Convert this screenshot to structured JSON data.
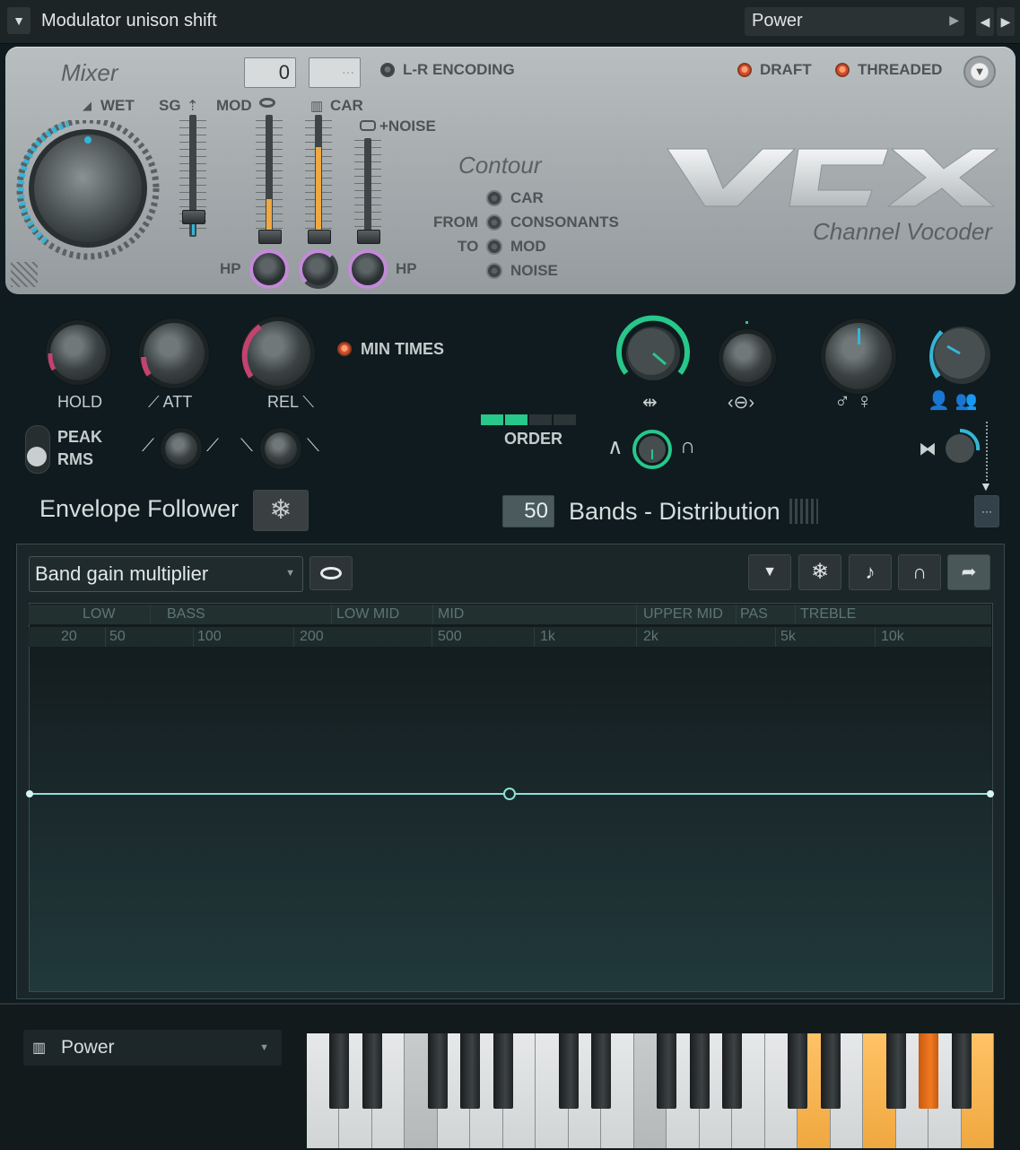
{
  "window": {
    "title": "Modulator unison shift",
    "preset": "Power"
  },
  "mixer": {
    "title": "Mixer",
    "value_box": "0",
    "blank_box": "···",
    "lr_encoding": "L-R ENCODING",
    "draft": "DRAFT",
    "threaded": "THREADED",
    "wet": "WET",
    "sg": "SG",
    "mod": "MOD",
    "car": "CAR",
    "noise": "+NOISE",
    "hp_left": "HP",
    "hp_right": "HP"
  },
  "contour": {
    "title": "Contour",
    "from": "FROM",
    "to": "TO",
    "options": [
      "CAR",
      "CONSONANTS",
      "MOD",
      "NOISE"
    ]
  },
  "brand": {
    "logo": "VCX",
    "subtitle": "Channel Vocoder"
  },
  "envelope": {
    "hold": "HOLD",
    "att": "ATT",
    "rel": "REL",
    "min_times": "MIN TIMES",
    "peak": "PEAK",
    "rms": "RMS",
    "title": "Envelope Follower"
  },
  "bands": {
    "order": "ORDER",
    "count": "50",
    "title": "Bands - Distribution"
  },
  "graph": {
    "selector": "Band gain multiplier",
    "regions": [
      {
        "label": "LOW BASS"
      },
      {
        "label": "BASS"
      },
      {
        "label": "LOW MID"
      },
      {
        "label": "MID"
      },
      {
        "label": "UPPER MID"
      },
      {
        "label": "PAS"
      },
      {
        "label": "TREBLE"
      }
    ],
    "freq_ticks": [
      "20",
      "50",
      "100",
      "200",
      "500",
      "1k",
      "2k",
      "5k",
      "10k"
    ]
  },
  "keyboard": {
    "preset": "Power"
  },
  "colors": {
    "accent_teal": "#7fe0d0",
    "accent_orange": "#f0a840",
    "knob_pink": "#c2436e",
    "knob_cyan": "#35b5d6",
    "knob_green": "#28c78a",
    "panel_silver": "#a8aeb0"
  }
}
